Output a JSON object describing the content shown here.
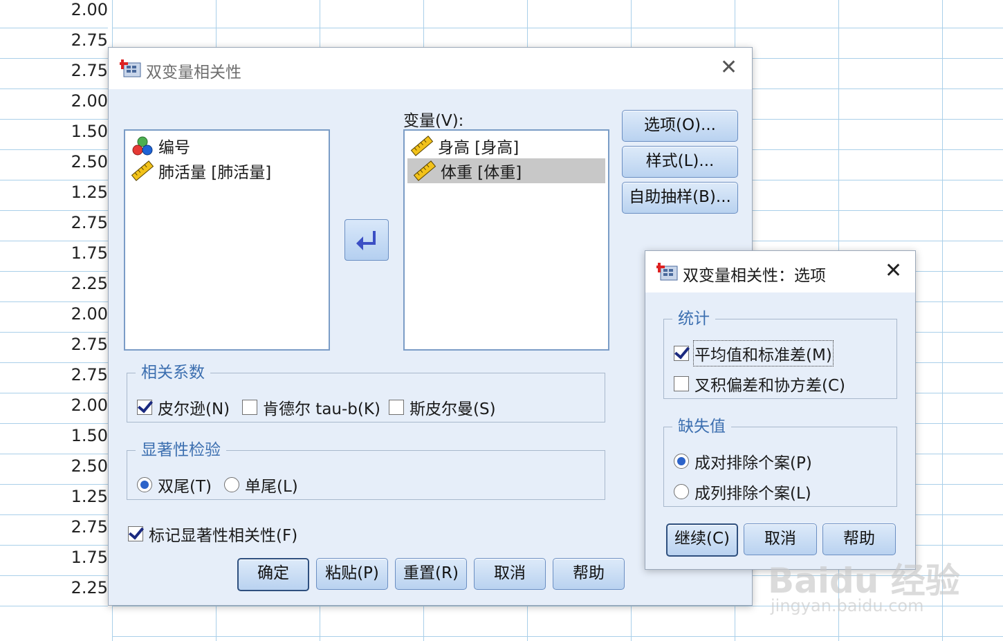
{
  "sheet": {
    "values": [
      "2.00",
      "2.75",
      "2.75",
      "2.00",
      "1.50",
      "2.50",
      "1.25",
      "2.75",
      "1.75",
      "2.25",
      "2.00",
      "2.75",
      "2.75",
      "2.00",
      "1.50",
      "2.50",
      "1.25",
      "2.75",
      "1.75",
      "2.25"
    ]
  },
  "main_dialog": {
    "title": "双变量相关性",
    "variables_label": "变量(V):",
    "source_list": [
      {
        "label": "编号",
        "icon": "nominal-variable-icon"
      },
      {
        "label": "肺活量 [肺活量]",
        "icon": "scale-ruler-icon"
      }
    ],
    "target_list": [
      {
        "label": "身高 [身高]",
        "icon": "scale-ruler-icon",
        "selected": false
      },
      {
        "label": "体重 [体重]",
        "icon": "scale-ruler-icon",
        "selected": true
      }
    ],
    "side_buttons": {
      "options": "选项(O)...",
      "style": "样式(L)...",
      "bootstrap": "自助抽样(B)..."
    },
    "correlation_group": {
      "title": "相关系数",
      "pearson": {
        "label": "皮尔逊(N)",
        "checked": true
      },
      "kendall": {
        "label": "肯德尔 tau-b(K)",
        "checked": false
      },
      "spearman": {
        "label": "斯皮尔曼(S)",
        "checked": false
      }
    },
    "significance_group": {
      "title": "显著性检验",
      "two_tailed": {
        "label": "双尾(T)",
        "selected": true
      },
      "one_tailed": {
        "label": "单尾(L)",
        "selected": false
      }
    },
    "flag_significant": {
      "label": "标记显著性相关性(F)",
      "checked": true
    },
    "bottom_buttons": {
      "ok": "确定",
      "paste": "粘贴(P)",
      "reset": "重置(R)",
      "cancel": "取消",
      "help": "帮助"
    }
  },
  "options_dialog": {
    "title": "双变量相关性：选项",
    "stats_group": {
      "title": "统计",
      "means": {
        "label": "平均值和标准差(M)",
        "checked": true
      },
      "crossprod": {
        "label": "叉积偏差和协方差(C)",
        "checked": false
      }
    },
    "missing_group": {
      "title": "缺失值",
      "pairwise": {
        "label": "成对排除个案(P)",
        "selected": true
      },
      "listwise": {
        "label": "成列排除个案(L)",
        "selected": false
      }
    },
    "buttons": {
      "continue": "继续(C)",
      "cancel": "取消",
      "help": "帮助"
    }
  },
  "watermark": {
    "main": "Baidu 经验",
    "sub": "jingyan.baidu.com"
  },
  "colors": {
    "dialog_bg": "#e6eef9",
    "group_title": "#3c6fb0",
    "selection": "#c8c8c8",
    "grid": "#a9cfe9"
  }
}
